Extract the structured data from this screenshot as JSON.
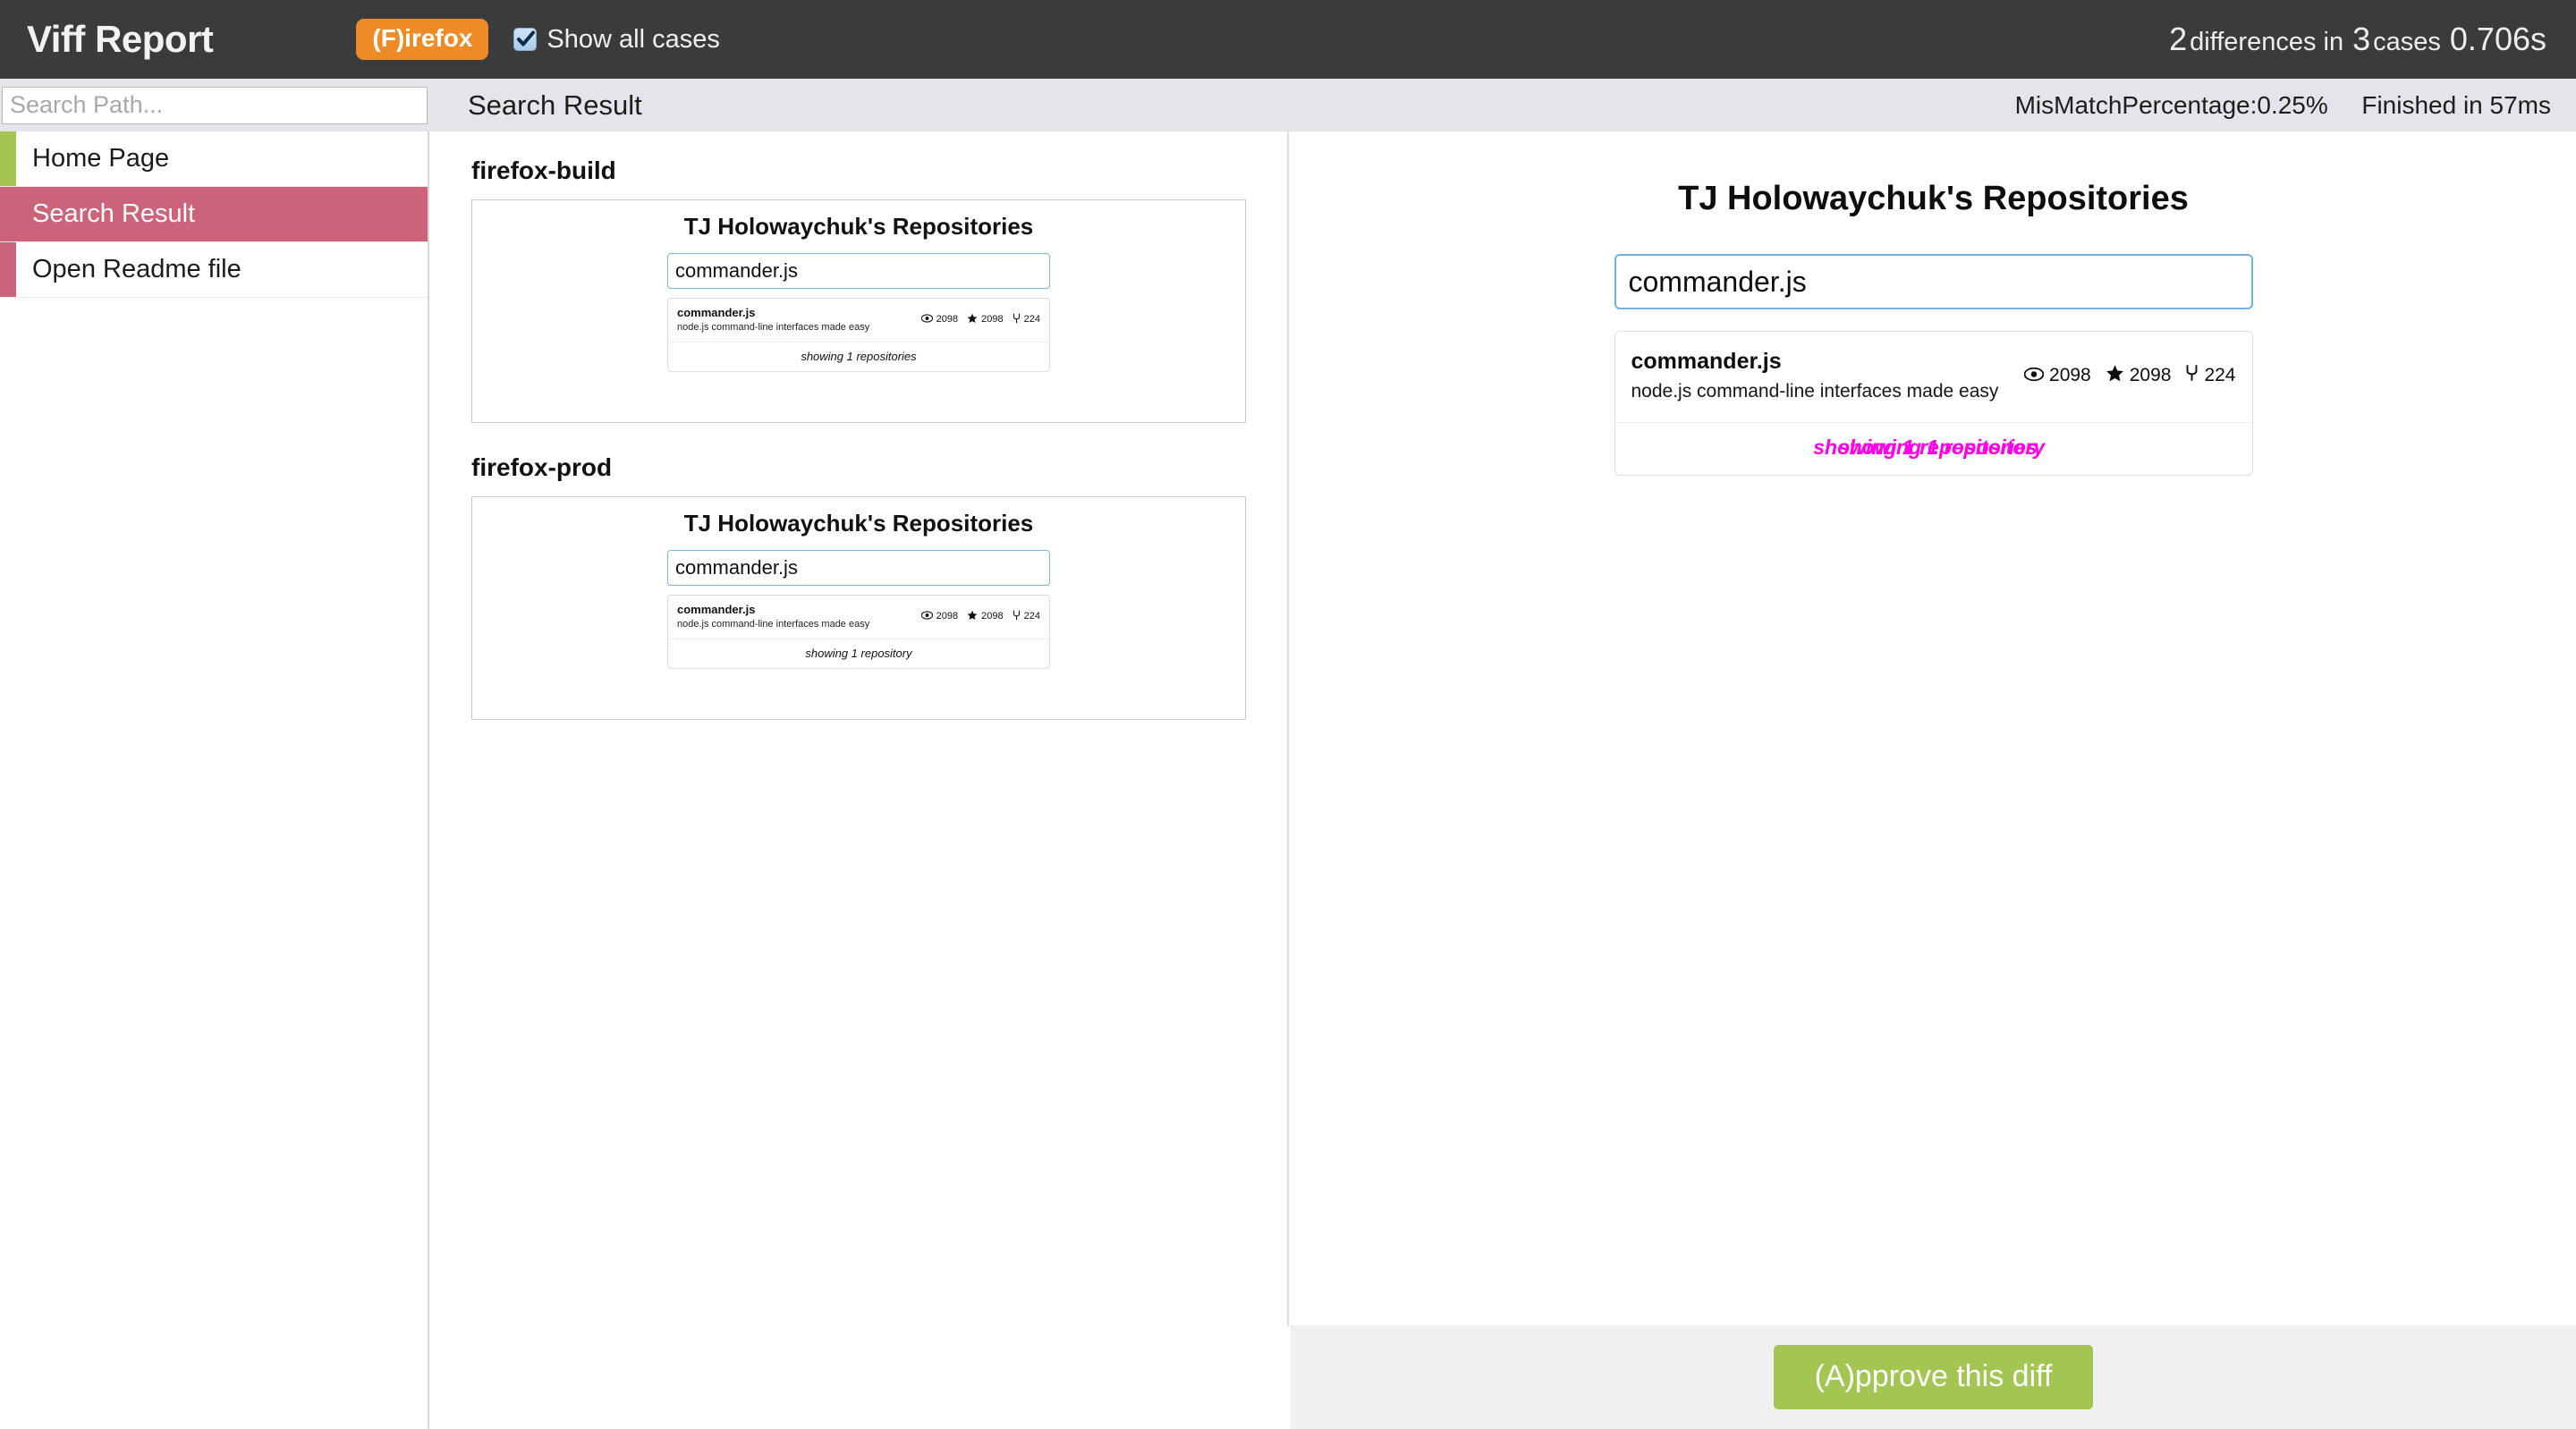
{
  "header": {
    "app_title": "Viff Report",
    "browser_badge": "(F)irefox",
    "show_all_label": "Show all cases",
    "show_all_checked": true,
    "summary": {
      "differences_count": "2",
      "differences_word": "differences in",
      "cases_count": "3",
      "cases_word": "cases",
      "duration": "0.706s"
    },
    "colors": {
      "bar_bg": "#3b3b3b",
      "badge_bg": "#ed8b27",
      "text": "#f0f0f0"
    }
  },
  "subheader": {
    "search_placeholder": "Search Path...",
    "search_value": "",
    "title": "Search Result",
    "mismatch": "MisMatchPercentage:0.25%",
    "finished": "Finished in 57ms"
  },
  "sidebar": {
    "items": [
      {
        "label": "Home Page",
        "accent": "#a3c653",
        "selected": false
      },
      {
        "label": "Search Result",
        "accent": "#cd637b",
        "selected": true
      },
      {
        "label": "Open Readme file",
        "accent": "#cd637b",
        "selected": false
      }
    ]
  },
  "cases": [
    {
      "title": "firefox-build",
      "page": {
        "heading": "TJ Holowaychuk's Repositories",
        "search_value": "commander.js",
        "repo": {
          "name": "commander.js",
          "description": "node.js command-line interfaces made easy",
          "watchers": "2098",
          "stars": "2098",
          "forks": "224"
        },
        "footer": "showing 1 repositories"
      }
    },
    {
      "title": "firefox-prod",
      "page": {
        "heading": "TJ Holowaychuk's Repositories",
        "search_value": "commander.js",
        "repo": {
          "name": "commander.js",
          "description": "node.js command-line interfaces made easy",
          "watchers": "2098",
          "stars": "2098",
          "forks": "224"
        },
        "footer": "showing 1 repository"
      }
    }
  ],
  "diff": {
    "heading": "TJ Holowaychuk's Repositories",
    "search_value": "commander.js",
    "repo": {
      "name": "commander.js",
      "description": "node.js command-line interfaces made easy",
      "watchers": "2098",
      "stars": "2098",
      "forks": "224"
    },
    "footer_a": "showing 1 repositories",
    "footer_b": "showing 1 repository",
    "highlight_color": "#ff00ea"
  },
  "footer": {
    "approve_label": "(A)pprove this diff",
    "approve_color": "#a3c653"
  }
}
